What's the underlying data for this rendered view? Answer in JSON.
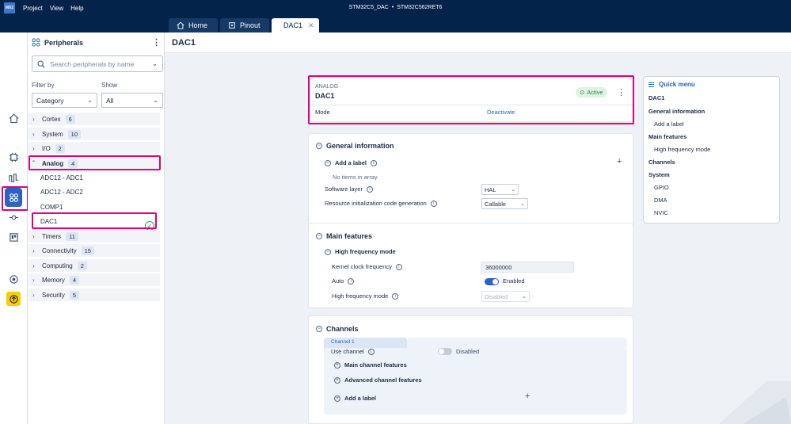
{
  "app": {
    "logo": "MX2",
    "title": "STM32C5_DAC",
    "mcu": "STM32C562RET6"
  },
  "menu": [
    "Project",
    "View",
    "Help"
  ],
  "tabs": [
    {
      "label": "Home"
    },
    {
      "label": "Pinout"
    },
    {
      "label": "DAC1"
    }
  ],
  "peripherals": {
    "title": "Peripherals",
    "search_placeholder": "Search peripherals by name",
    "filter_by_label": "Filter by",
    "filter_by_value": "Category",
    "show_label": "Show",
    "show_value": "All",
    "categories": [
      {
        "name": "Cortex",
        "count": "6"
      },
      {
        "name": "System",
        "count": "10"
      },
      {
        "name": "I/O",
        "count": "2"
      },
      {
        "name": "Analog",
        "count": "4"
      },
      {
        "name": "Timers",
        "count": "11"
      },
      {
        "name": "Connectivity",
        "count": "15"
      },
      {
        "name": "Computing",
        "count": "2"
      },
      {
        "name": "Memory",
        "count": "4"
      },
      {
        "name": "Security",
        "count": "5"
      }
    ],
    "analog_items": [
      "ADC12 - ADC1",
      "ADC12 - ADC2",
      "COMP1",
      "DAC1"
    ]
  },
  "page": {
    "title": "DAC1"
  },
  "ip_card": {
    "category": "ANALOG",
    "name": "DAC1",
    "status": "Active",
    "mode_label": "Mode",
    "deactivate_label": "Deactivate"
  },
  "general": {
    "title": "General information",
    "add_label": "Add a label",
    "no_items": "No items in array",
    "software_layer_label": "Software layer",
    "software_layer_value": "HAL",
    "resource_label": "Resource initialization code generation",
    "resource_value": "Callable"
  },
  "main_features": {
    "title": "Main features",
    "subsection": "High frequency mode",
    "kernel_clock_label": "Kernel clock frequency",
    "kernel_clock_value": "36000000",
    "auto_label": "Auto",
    "auto_state": "Enabled",
    "hf_mode_label": "High frequency mode",
    "hf_mode_value": "Disabled"
  },
  "channels": {
    "title": "Channels",
    "tab": "Channel 1",
    "use_channel_label": "Use channel",
    "use_channel_state": "Disabled",
    "main_channel_features": "Main channel features",
    "advanced_channel_features": "Advanced channel features",
    "add_label": "Add a label"
  },
  "quick_menu": {
    "title": "Quick menu",
    "items": [
      {
        "label": "DAC1",
        "bold": true
      },
      {
        "label": "General information",
        "bold": true
      },
      {
        "label": "Add a label",
        "bold": false
      },
      {
        "label": "Main features",
        "bold": true
      },
      {
        "label": "High frequency mode",
        "bold": false
      },
      {
        "label": "Channels",
        "bold": true
      },
      {
        "label": "System",
        "bold": true
      },
      {
        "label": "GPIO",
        "bold": false
      },
      {
        "label": "DMA",
        "bold": false
      },
      {
        "label": "NVIC",
        "bold": false
      }
    ]
  },
  "colors": {
    "navy": "#03234b",
    "accent": "#2b62c6",
    "highlight": "#e3007d",
    "active_green": "#2e8a41"
  }
}
